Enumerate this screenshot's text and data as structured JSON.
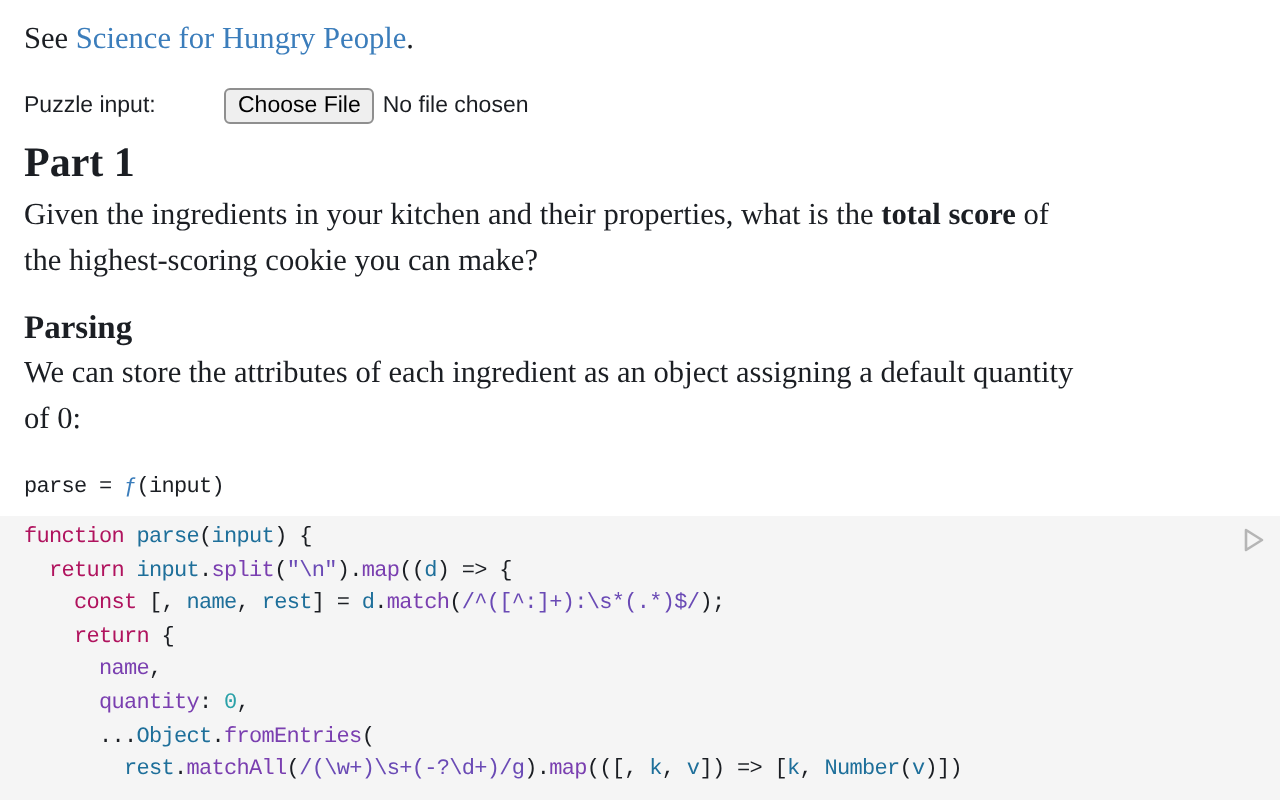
{
  "intro": {
    "prefix": "See ",
    "link": "Science for Hungry People",
    "suffix": "."
  },
  "file_input": {
    "label": "Puzzle input:",
    "button": "Choose File",
    "status": "No file chosen"
  },
  "heading": "Part 1",
  "question": "Given the ingredients in your kitchen and their properties, what is the **total score** of the highest-scoring cookie you can make?",
  "subheading": "Parsing",
  "description": "We can store the attributes of each ingredient as an object assigning a default quantity of 0:",
  "cell_output": [
    {
      "kind": "plain",
      "text": "parse = "
    },
    {
      "kind": "fn",
      "text": "ƒ"
    },
    {
      "kind": "plain",
      "text": "(input)"
    }
  ],
  "code": {
    "lines": [
      [
        {
          "kind": "kw",
          "text": "function"
        },
        {
          "kind": "def",
          "text": " parse"
        },
        {
          "kind": "plain",
          "text": "("
        },
        {
          "kind": "var",
          "text": "input"
        },
        {
          "kind": "plain",
          "text": ") {"
        }
      ],
      [
        {
          "kind": "kw",
          "text": "  return"
        },
        {
          "kind": "var",
          "text": " input"
        },
        {
          "kind": "plain",
          "text": "."
        },
        {
          "kind": "prop",
          "text": "split"
        },
        {
          "kind": "plain",
          "text": "("
        },
        {
          "kind": "str",
          "text": "\"\\n\""
        },
        {
          "kind": "plain",
          "text": ")."
        },
        {
          "kind": "prop",
          "text": "map"
        },
        {
          "kind": "plain",
          "text": "(("
        },
        {
          "kind": "var",
          "text": "d"
        },
        {
          "kind": "plain",
          "text": ") => {"
        }
      ],
      [
        {
          "kind": "kw",
          "text": "    const"
        },
        {
          "kind": "plain",
          "text": " [, "
        },
        {
          "kind": "var",
          "text": "name"
        },
        {
          "kind": "plain",
          "text": ", "
        },
        {
          "kind": "var",
          "text": "rest"
        },
        {
          "kind": "plain",
          "text": "] = "
        },
        {
          "kind": "var",
          "text": "d"
        },
        {
          "kind": "plain",
          "text": "."
        },
        {
          "kind": "prop",
          "text": "match"
        },
        {
          "kind": "plain",
          "text": "("
        },
        {
          "kind": "str",
          "text": "/^([^:]+):\\s*(.*)$/"
        },
        {
          "kind": "plain",
          "text": ");"
        }
      ],
      [
        {
          "kind": "kw",
          "text": "    return"
        },
        {
          "kind": "plain",
          "text": " {"
        }
      ],
      [
        {
          "kind": "prop",
          "text": "      name"
        },
        {
          "kind": "plain",
          "text": ","
        }
      ],
      [
        {
          "kind": "prop",
          "text": "      quantity"
        },
        {
          "kind": "plain",
          "text": ": "
        },
        {
          "kind": "num",
          "text": "0"
        },
        {
          "kind": "plain",
          "text": ","
        }
      ],
      [
        {
          "kind": "plain",
          "text": "      ..."
        },
        {
          "kind": "var",
          "text": "Object"
        },
        {
          "kind": "plain",
          "text": "."
        },
        {
          "kind": "prop",
          "text": "fromEntries"
        },
        {
          "kind": "plain",
          "text": "("
        }
      ],
      [
        {
          "kind": "var",
          "text": "        rest"
        },
        {
          "kind": "plain",
          "text": "."
        },
        {
          "kind": "prop",
          "text": "matchAll"
        },
        {
          "kind": "plain",
          "text": "("
        },
        {
          "kind": "str",
          "text": "/(\\w+)\\s+(-?\\d+)/g"
        },
        {
          "kind": "plain",
          "text": ")."
        },
        {
          "kind": "prop",
          "text": "map"
        },
        {
          "kind": "plain",
          "text": "(([, "
        },
        {
          "kind": "var",
          "text": "k"
        },
        {
          "kind": "plain",
          "text": ", "
        },
        {
          "kind": "var",
          "text": "v"
        },
        {
          "kind": "plain",
          "text": "]) => ["
        },
        {
          "kind": "var",
          "text": "k"
        },
        {
          "kind": "plain",
          "text": ", "
        },
        {
          "kind": "var",
          "text": "Number"
        },
        {
          "kind": "plain",
          "text": "("
        },
        {
          "kind": "var",
          "text": "v"
        },
        {
          "kind": "plain",
          "text": ")])"
        }
      ]
    ]
  }
}
